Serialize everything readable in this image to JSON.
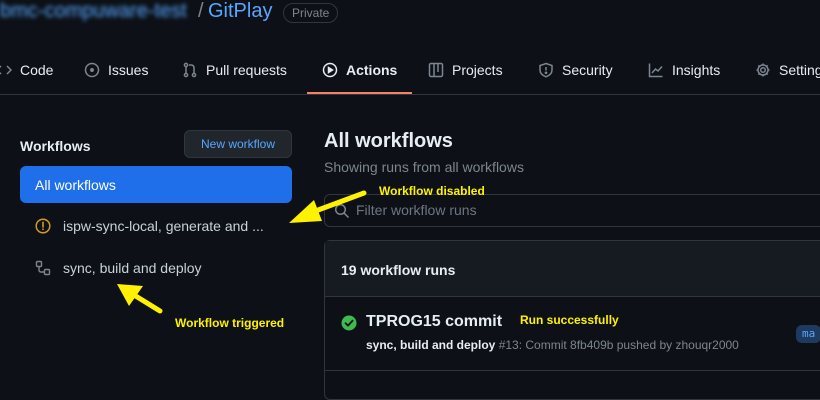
{
  "header": {
    "owner": "bmc-compuware-test",
    "slash": "/",
    "repo": "GitPlay",
    "visibility": "Private"
  },
  "tabs": [
    {
      "label": "Code",
      "icon": "code-icon"
    },
    {
      "label": "Issues",
      "icon": "issue-icon"
    },
    {
      "label": "Pull requests",
      "icon": "pull-request-icon"
    },
    {
      "label": "Actions",
      "icon": "play-icon",
      "active": true
    },
    {
      "label": "Projects",
      "icon": "table-icon"
    },
    {
      "label": "Security",
      "icon": "shield-icon"
    },
    {
      "label": "Insights",
      "icon": "graph-icon"
    },
    {
      "label": "Settings",
      "icon": "gear-icon"
    }
  ],
  "sidebar": {
    "heading": "Workflows",
    "new_workflow": "New workflow",
    "all_workflows": "All workflows",
    "items": [
      {
        "label": "ispw-sync-local, generate and ...",
        "status": "disabled",
        "icon": "alert-icon"
      },
      {
        "label": "sync, build and deploy",
        "status": "active",
        "icon": "workflow-icon"
      }
    ]
  },
  "main": {
    "title": "All workflows",
    "subtitle": "Showing runs from all workflows",
    "filter_placeholder": "Filter workflow runs",
    "runs_count": "19 workflow runs",
    "run": {
      "title": "TPROG15 commit",
      "workflow": "sync, build and deploy",
      "detail": " #13: Commit 8fb409b pushed by zhouqr2000",
      "branch": "ma",
      "status": "success"
    }
  },
  "annotations": {
    "disabled": "Workflow disabled",
    "triggered": "Workflow triggered",
    "success": "Run successfully"
  },
  "colors": {
    "background": "#0d1117",
    "accent": "#1f6feb",
    "link": "#58a6ff",
    "tab_underline": "#f78166",
    "annotation": "#fff200",
    "success": "#3fb950",
    "warning": "#d29922"
  }
}
